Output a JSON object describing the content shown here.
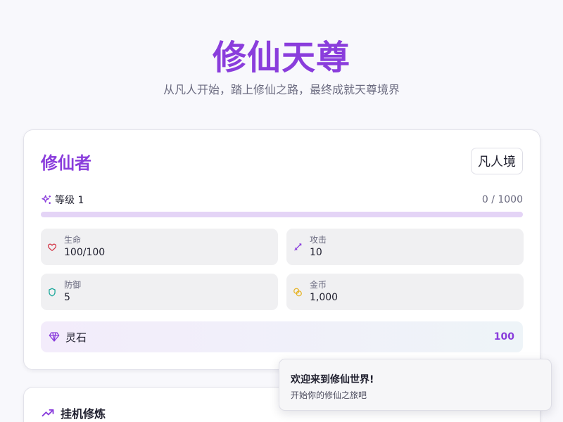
{
  "hero": {
    "title": "修仙天尊",
    "subtitle": "从凡人开始，踏上修仙之路，最终成就天尊境界"
  },
  "character": {
    "name": "修仙者",
    "realm": "凡人境",
    "level_label": "等级 1",
    "exp_text": "0 / 1000",
    "exp_progress": 0,
    "stats": [
      {
        "key": "hp",
        "label": "生命",
        "value": "100/100",
        "icon": "heart-icon",
        "color": "#d33a4a"
      },
      {
        "key": "attack",
        "label": "攻击",
        "value": "10",
        "icon": "sword-icon",
        "color": "#8a3ddc"
      },
      {
        "key": "defense",
        "label": "防御",
        "value": "5",
        "icon": "shield-icon",
        "color": "#1aa79a"
      },
      {
        "key": "gold",
        "label": "金币",
        "value": "1,000",
        "icon": "coins-icon",
        "color": "#e6b325"
      }
    ],
    "spirit_stones": {
      "label": "灵石",
      "value": "100",
      "icon": "gem-icon"
    }
  },
  "idle": {
    "title": "挂机修炼",
    "icon": "trending-up-icon"
  },
  "toast": {
    "title": "欢迎来到修仙世界!",
    "description": "开始你的修仙之旅吧"
  },
  "colors": {
    "accent": "#8a3ddc",
    "background": "#f8f8fc"
  }
}
